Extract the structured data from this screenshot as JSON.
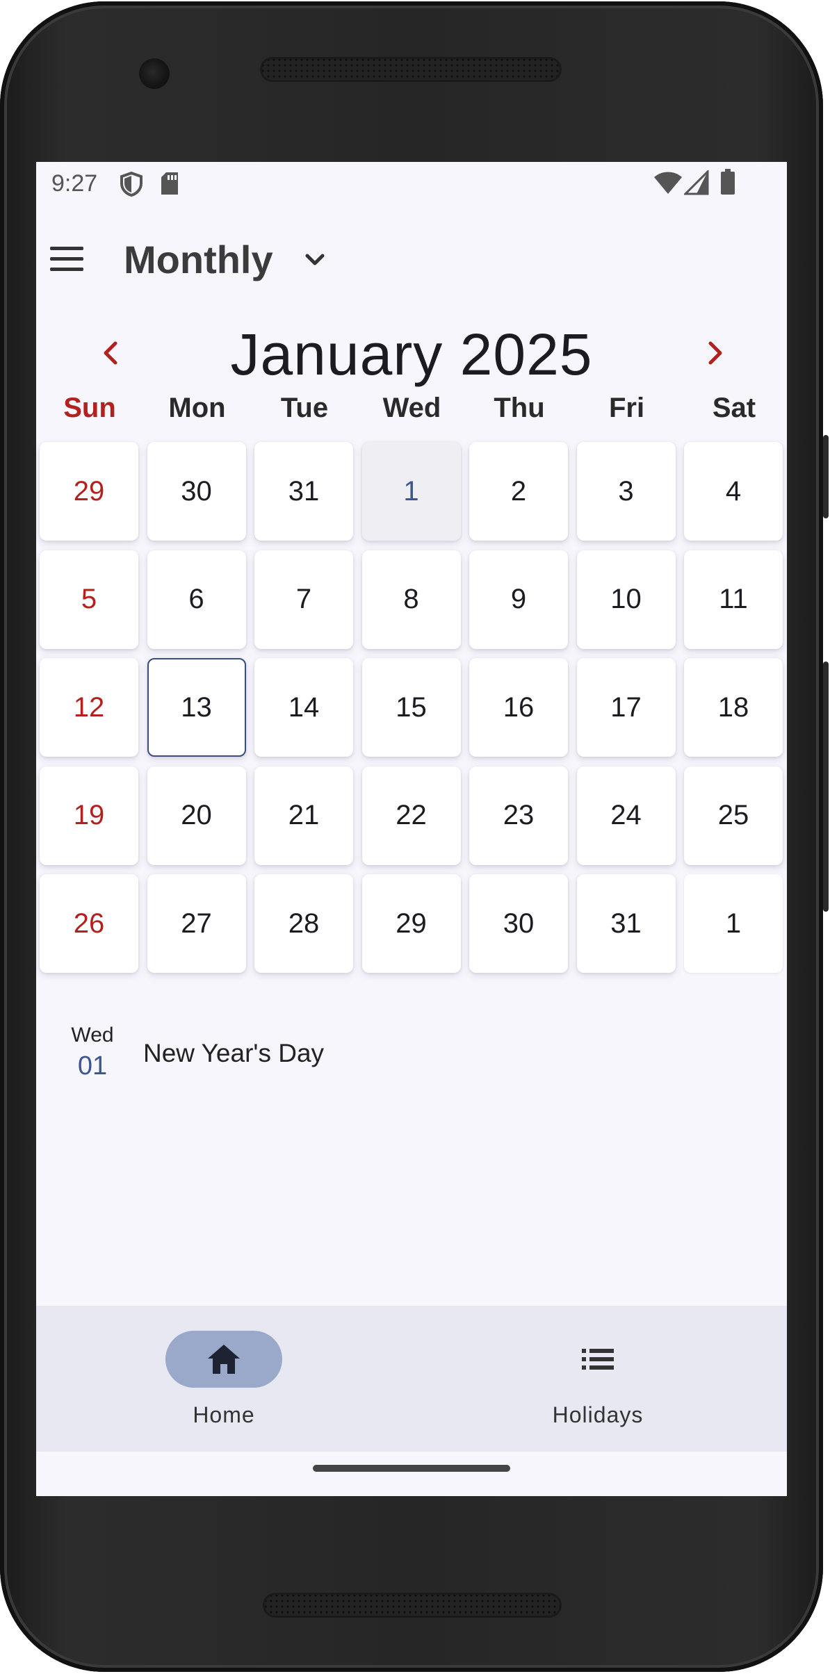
{
  "status_bar": {
    "time": "9:27",
    "icons": [
      "shield-icon",
      "sd-card-icon",
      "wifi-icon",
      "signal-icon",
      "battery-icon"
    ]
  },
  "top_bar": {
    "title": "Monthly",
    "menu_icon": "menu-icon",
    "dropdown_icon": "chevron-down-icon"
  },
  "calendar": {
    "month_label": "January 2025",
    "prev_icon": "chevron-left-icon",
    "next_icon": "chevron-right-icon",
    "weekdays": [
      "Sun",
      "Mon",
      "Tue",
      "Wed",
      "Thu",
      "Fri",
      "Sat"
    ],
    "weeks": [
      [
        "29",
        "30",
        "31",
        "1",
        "2",
        "3",
        "4"
      ],
      [
        "5",
        "6",
        "7",
        "8",
        "9",
        "10",
        "11"
      ],
      [
        "12",
        "13",
        "14",
        "15",
        "16",
        "17",
        "18"
      ],
      [
        "19",
        "20",
        "21",
        "22",
        "23",
        "24",
        "25"
      ],
      [
        "26",
        "27",
        "28",
        "29",
        "30",
        "31",
        "1"
      ]
    ],
    "selected_date": "13",
    "holiday_dates": [
      "1"
    ]
  },
  "holidays": [
    {
      "dow": "Wed",
      "day": "01",
      "name": "New Year's Day"
    }
  ],
  "bottom_nav": {
    "items": [
      {
        "label": "Home",
        "icon": "home-icon",
        "active": true
      },
      {
        "label": "Holidays",
        "icon": "list-icon",
        "active": false
      }
    ]
  },
  "colors": {
    "sunday": "#b3211e",
    "accent": "#3d5595",
    "nav_active_pill": "#9aa8c9",
    "screen_bg": "#f7f6fc",
    "nav_bg": "#e8e8f3"
  }
}
